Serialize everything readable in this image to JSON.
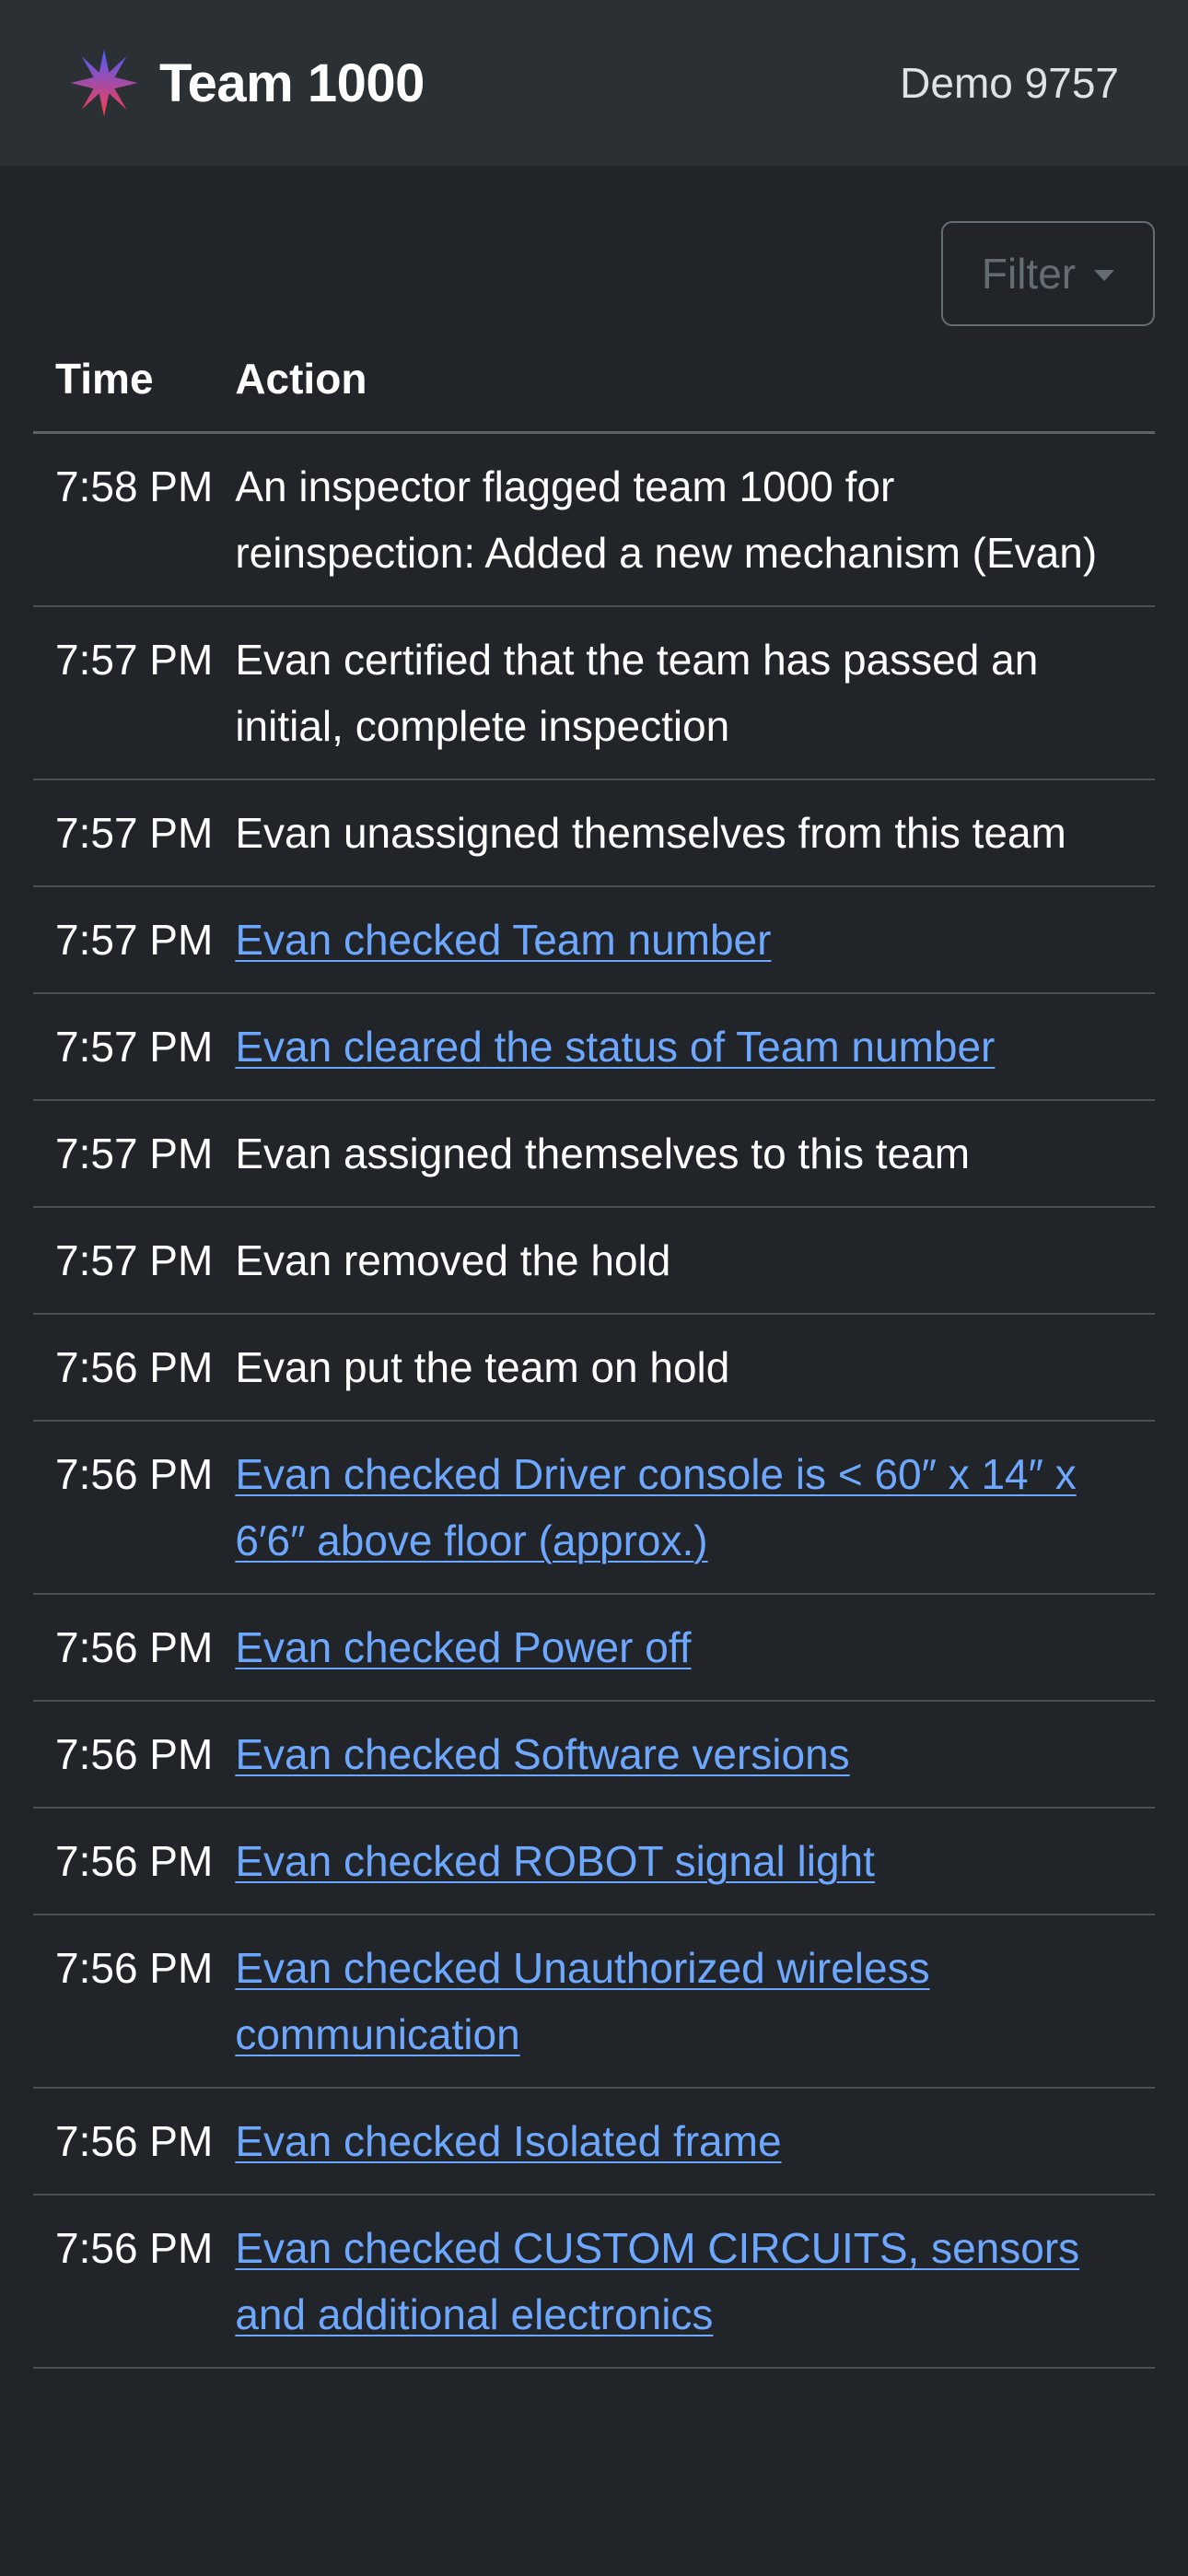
{
  "header": {
    "team_title": "Team 1000",
    "event_name": "Demo 9757",
    "logo_icon": "star-burst-logo-icon",
    "colors": {
      "logo_blue": "#4a5cff",
      "logo_red": "#ff3b4a",
      "navbar_bg": "#2b3035"
    }
  },
  "filter": {
    "label": "Filter"
  },
  "table": {
    "columns": {
      "time": "Time",
      "action": "Action"
    },
    "rows": [
      {
        "time": "7:58 PM",
        "action": "An inspector flagged team 1000 for reinspection: Added a new mechanism (Evan)",
        "link": false
      },
      {
        "time": "7:57 PM",
        "action": "Evan certified that the team has passed an initial, complete inspection",
        "link": false
      },
      {
        "time": "7:57 PM",
        "action": "Evan unassigned themselves from this team",
        "link": false
      },
      {
        "time": "7:57 PM",
        "action": "Evan checked Team number",
        "link": true
      },
      {
        "time": "7:57 PM",
        "action": "Evan cleared the status of Team number",
        "link": true
      },
      {
        "time": "7:57 PM",
        "action": "Evan assigned themselves to this team",
        "link": false
      },
      {
        "time": "7:57 PM",
        "action": "Evan removed the hold",
        "link": false
      },
      {
        "time": "7:56 PM",
        "action": "Evan put the team on hold",
        "link": false
      },
      {
        "time": "7:56 PM",
        "action": "Evan checked Driver console is < 60″ x 14″ x 6′6″ above floor (approx.)",
        "link": true
      },
      {
        "time": "7:56 PM",
        "action": "Evan checked Power off",
        "link": true
      },
      {
        "time": "7:56 PM",
        "action": "Evan checked Software versions",
        "link": true
      },
      {
        "time": "7:56 PM",
        "action": "Evan checked ROBOT signal light",
        "link": true
      },
      {
        "time": "7:56 PM",
        "action": "Evan checked Unauthorized wireless communication",
        "link": true
      },
      {
        "time": "7:56 PM",
        "action": "Evan checked Isolated frame",
        "link": true
      },
      {
        "time": "7:56 PM",
        "action": "Evan checked CUSTOM CIRCUITS, sensors and additional electronics",
        "link": true
      }
    ]
  }
}
